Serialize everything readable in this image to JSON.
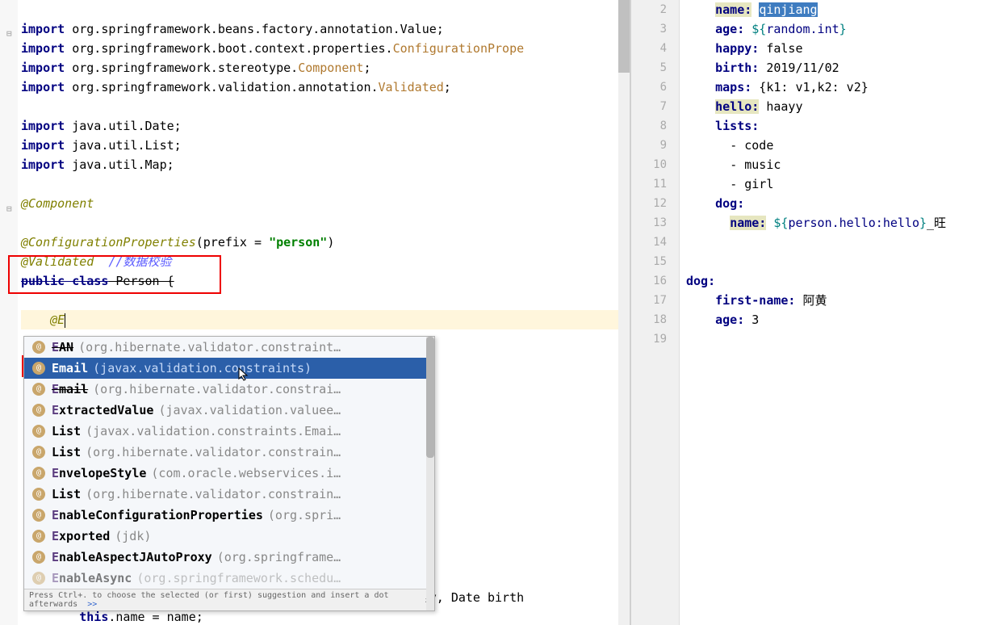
{
  "left_editor": {
    "imports": [
      {
        "kw": "import",
        "pkg": "org.springframework.beans.factory.annotation.",
        "cls": "Value",
        "end": ";"
      },
      {
        "kw": "import",
        "pkg": "org.springframework.boot.context.properties.",
        "cls": "ConfigurationPrope",
        "end": "",
        "hl": true
      },
      {
        "kw": "import",
        "pkg": "org.springframework.stereotype.",
        "cls": "Component",
        "end": ";",
        "hl": true
      },
      {
        "kw": "import",
        "pkg": "org.springframework.validation.annotation.",
        "cls": "Validated",
        "end": ";",
        "hl": true
      },
      {
        "kw": "",
        "pkg": "",
        "cls": "",
        "end": ""
      },
      {
        "kw": "import",
        "pkg": "java.util.Date",
        "cls": "",
        "end": ";"
      },
      {
        "kw": "import",
        "pkg": "java.util.List",
        "cls": "",
        "end": ";"
      },
      {
        "kw": "import",
        "pkg": "java.util.Map",
        "cls": "",
        "end": ";"
      }
    ],
    "ann_component": "@Component",
    "ann_cfg": "@ConfigurationProperties",
    "ann_cfg_args": "(prefix = ",
    "ann_cfg_str": "\"person\"",
    "ann_cfg_close": ")",
    "ann_validated": "@Validated",
    "validated_comment": "  //数据校验",
    "class_decl_kw": "public class",
    "class_decl_name": " Person {",
    "typing": "    @E",
    "ctor_line": "    public Person(String name, Integer age, Boolean happy, Date birth",
    "ctor_body_this": "        this",
    "ctor_body_rest": ".name = name;"
  },
  "autocomplete": {
    "hint": "Press Ctrl+. to choose the selected (or first) suggestion and insert a dot afterwards",
    "hint_link": ">>",
    "pi": "π",
    "items": [
      {
        "match": "E",
        "rest": "AN",
        "pkg": " (org.hibernate.validator.constraint…",
        "deprecated": true
      },
      {
        "match": "E",
        "rest": "mail",
        "pkg": " (javax.validation.constraints)",
        "selected": true
      },
      {
        "match": "E",
        "rest": "mail",
        "pkg": " (org.hibernate.validator.constrai…",
        "deprecated": true
      },
      {
        "match": "E",
        "rest": "xtractedValue",
        "pkg": " (javax.validation.valuee…"
      },
      {
        "match": "",
        "rest": "List",
        "pkg": " (javax.validation.constraints.Emai…"
      },
      {
        "match": "",
        "rest": "List",
        "pkg": " (org.hibernate.validator.constrain…"
      },
      {
        "match": "E",
        "rest": "nvelopeStyle",
        "pkg": " (com.oracle.webservices.i…"
      },
      {
        "match": "",
        "rest": "List",
        "pkg": " (org.hibernate.validator.constrain…"
      },
      {
        "match": "E",
        "rest": "nableConfigurationProperties",
        "pkg": " (org.spri…"
      },
      {
        "match": "E",
        "rest": "xported",
        "pkg": " (jdk)"
      },
      {
        "match": "E",
        "rest": "nableAspectJAutoProxy",
        "pkg": " (org.springframe…"
      },
      {
        "match": "E",
        "rest": "nableAsync",
        "pkg": " (org.springframework.schedu…",
        "faded": true
      }
    ]
  },
  "right_editor": {
    "lines": [
      {
        "num": "2",
        "indent": "    ",
        "key": "name:",
        "val": " qinjiang",
        "key_hl": true,
        "val_sel": true
      },
      {
        "num": "3",
        "indent": "    ",
        "key": "age:",
        "val_pre": " ",
        "expr": "${random.int}"
      },
      {
        "num": "4",
        "indent": "    ",
        "key": "happy:",
        "val": " false"
      },
      {
        "num": "5",
        "indent": "    ",
        "key": "birth:",
        "val": " 2019/11/02"
      },
      {
        "num": "6",
        "indent": "    ",
        "key": "maps:",
        "val": " {k1: v1,k2: v2}"
      },
      {
        "num": "7",
        "indent": "    ",
        "key": "hello:",
        "val": " haayy",
        "key_hl": true
      },
      {
        "num": "8",
        "indent": "    ",
        "key": "lists:",
        "val": ""
      },
      {
        "num": "9",
        "indent": "      ",
        "plain": "- code"
      },
      {
        "num": "10",
        "indent": "      ",
        "plain": "- music"
      },
      {
        "num": "11",
        "indent": "      ",
        "plain": "- girl"
      },
      {
        "num": "12",
        "indent": "    ",
        "key": "dog:",
        "val": ""
      },
      {
        "num": "13",
        "indent": "      ",
        "key": "name:",
        "val_pre": " ",
        "expr": "${person.hello:hello}",
        "expr_tail": "_旺",
        "key_hl": true
      },
      {
        "num": "14",
        "indent": "",
        "plain": ""
      },
      {
        "num": "15",
        "indent": "",
        "plain": ""
      },
      {
        "num": "16",
        "indent": "",
        "key": "dog:",
        "val": ""
      },
      {
        "num": "17",
        "indent": "    ",
        "key": "first-name:",
        "val": " 阿黄"
      },
      {
        "num": "18",
        "indent": "    ",
        "key": "age:",
        "val": " 3"
      },
      {
        "num": "19",
        "indent": "",
        "plain": ""
      }
    ]
  }
}
